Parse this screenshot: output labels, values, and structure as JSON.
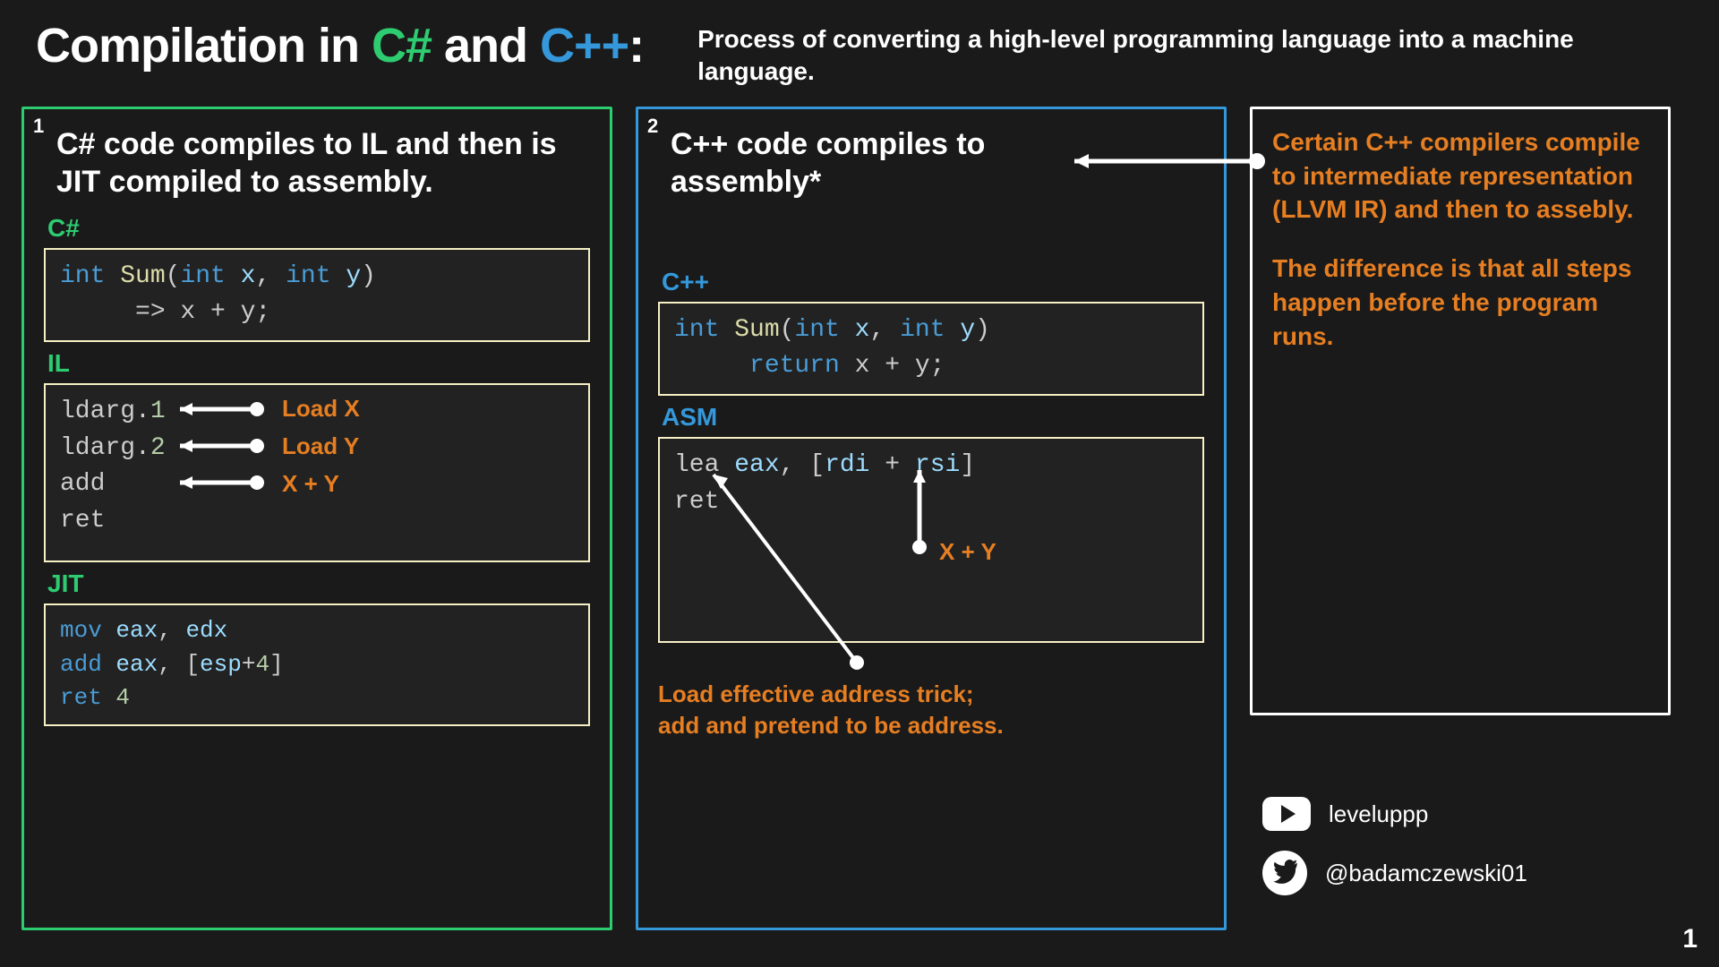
{
  "header": {
    "title_prefix": "Compilation in ",
    "csharp": "C#",
    "and": " and ",
    "cpp": "C++",
    "colon": ":",
    "subtitle": "Process of converting a high-level programming language into a machine language."
  },
  "panel_csharp": {
    "num": "1",
    "heading": "C# code compiles to IL and then is JIT compiled to assembly.",
    "label_cs": "C#",
    "code_cs_l1_kw": "int",
    "code_cs_l1_fn": " Sum",
    "code_cs_l1_rest_a": "(",
    "code_cs_l1_kw2": "int",
    "code_cs_l1_x": " x",
    "code_cs_l1_comma": ", ",
    "code_cs_l1_kw3": "int",
    "code_cs_l1_y": " y",
    "code_cs_l1_close": ")",
    "code_cs_l2": "     => x + y;",
    "label_il": "IL",
    "il_l1_a": "ldarg.",
    "il_l1_b": "1",
    "il_l2_a": "ldarg.",
    "il_l2_b": "2",
    "il_l3": "add",
    "il_l4": "ret",
    "annot_loadx": "Load X",
    "annot_loady": "Load Y",
    "annot_xpy": "X + Y",
    "label_jit": "JIT",
    "jit_l1_a": "mov ",
    "jit_l1_b": "eax",
    "jit_l1_c": ", ",
    "jit_l1_d": "edx",
    "jit_l2_a": "add ",
    "jit_l2_b": "eax",
    "jit_l2_c": ", [",
    "jit_l2_d": "esp",
    "jit_l2_e": "+",
    "jit_l2_f": "4",
    "jit_l2_g": "]",
    "jit_l3_a": "ret ",
    "jit_l3_b": "4"
  },
  "panel_cpp": {
    "num": "2",
    "heading": "C++ code compiles to assembly*",
    "label_cpp": "C++",
    "code_cpp_l1_kw": "int",
    "code_cpp_l1_fn": " Sum",
    "code_cpp_l1_a": "(",
    "code_cpp_l1_kw2": "int",
    "code_cpp_l1_x": " x",
    "code_cpp_l1_comma": ", ",
    "code_cpp_l1_kw3": "int",
    "code_cpp_l1_y": " y",
    "code_cpp_l1_close": ")",
    "code_cpp_l2_pad": "     ",
    "code_cpp_l2_kw": "return",
    "code_cpp_l2_rest": " x + y;",
    "label_asm": "ASM",
    "asm_l1_a": "lea ",
    "asm_l1_b": "eax",
    "asm_l1_c": ", [",
    "asm_l1_d": "rdi",
    "asm_l1_e": " + ",
    "asm_l1_f": "rsi",
    "asm_l1_g": "]",
    "asm_l2": "ret",
    "annot_xpy": "X + Y",
    "callout": "Load effective address trick;\nadd and pretend to be address."
  },
  "panel_note": {
    "p1": "Certain C++ compilers compile to intermediate representation",
    "p1b": "(LLVM IR) and then to assebly.",
    "p2": "The difference is that all steps happen before the program runs."
  },
  "socials": {
    "youtube": "leveluppp",
    "twitter": "@badamczewski01"
  },
  "page_number": "1"
}
